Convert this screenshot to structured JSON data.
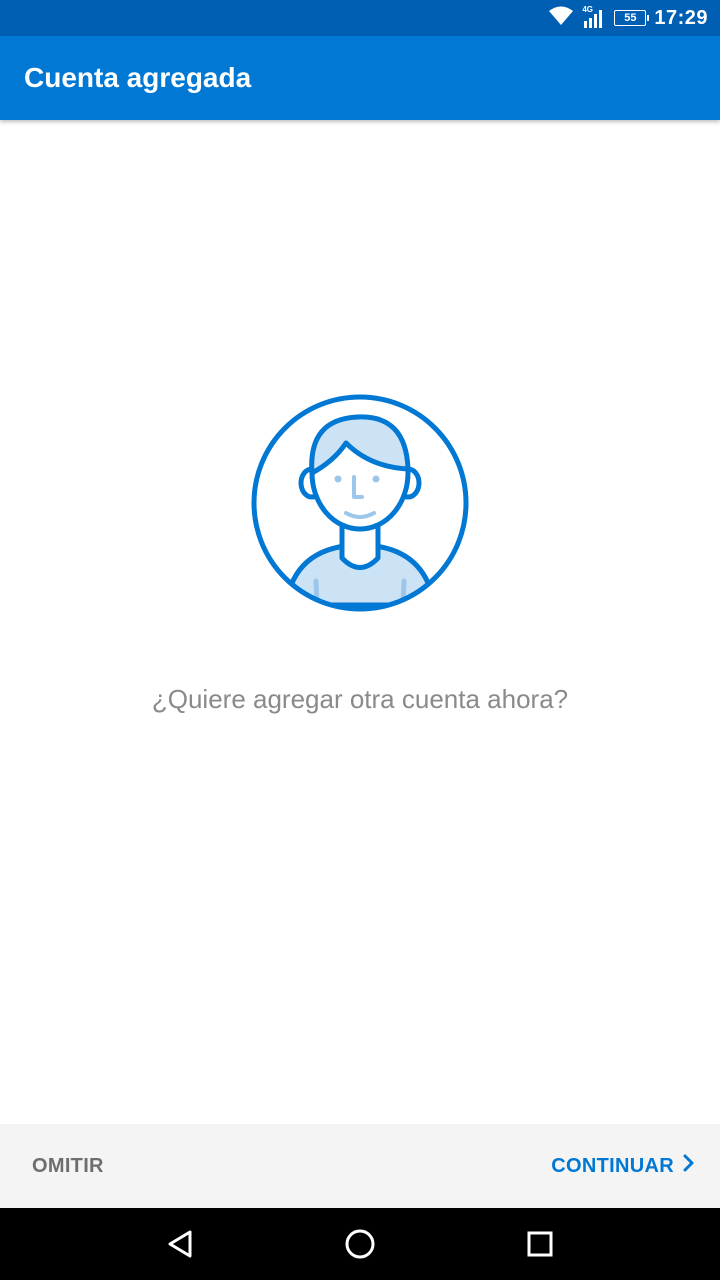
{
  "status_bar": {
    "network_label": "4G",
    "battery_level": "55",
    "time": "17:29"
  },
  "app_bar": {
    "title": "Cuenta agregada"
  },
  "main": {
    "illustration": "person-avatar-icon",
    "question": "¿Quiere agregar otra cuenta ahora?"
  },
  "bottom_bar": {
    "skip_label": "OMITIR",
    "continue_label": "CONTINUAR"
  },
  "nav_bar": {
    "back": "back-icon",
    "home": "home-icon",
    "recents": "recents-icon"
  },
  "colors": {
    "status_bar": "#005fb3",
    "app_bar": "#0078d4",
    "accent": "#0078d4",
    "avatar_fill": "#cce3f6",
    "question_text": "#8a8a8a",
    "bottom_bar": "#f4f4f4"
  }
}
